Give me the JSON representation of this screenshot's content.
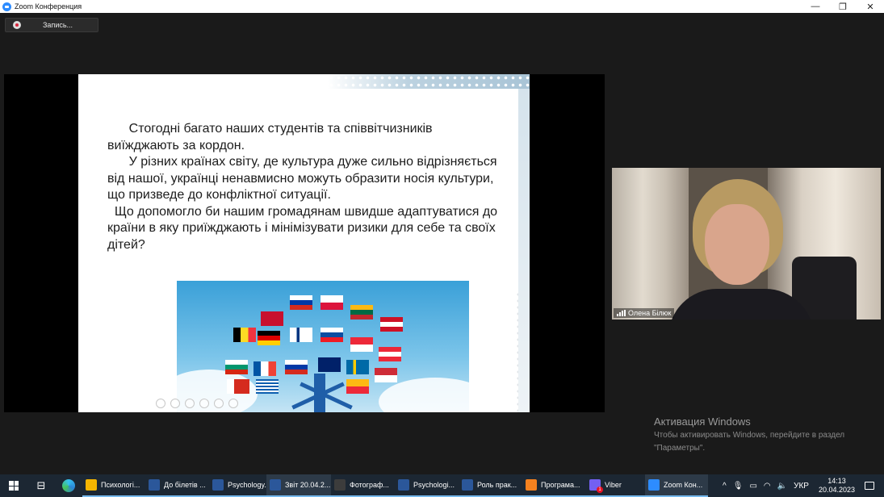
{
  "window": {
    "title": "Zoom Конференция",
    "controls": {
      "minimize": "—",
      "restore": "❐",
      "close": "✕"
    }
  },
  "recording": {
    "label": "Запись..."
  },
  "slide": {
    "paragraphs": [
      "      Стогодні багато наших студентів та співвітчизників",
      "виїжджають за кордон.",
      "      У різних країнах світу, де культура дуже сильно відрізняється",
      "від нашої, українці ненавмисно можуть образити носія культури,",
      "що призведе до конфліктної ситуації.",
      "  Що допомогло би нашим громадянам швидше адаптуватися до",
      "країни в яку приїжджають і мінімізувати ризики для себе та своїх",
      "дітей?"
    ]
  },
  "participant": {
    "name": "Олена Білюк"
  },
  "activation": {
    "title": "Активация Windows",
    "line1": "Чтобы активировать Windows, перейдите в раздел",
    "line2": "\"Параметры\"."
  },
  "taskbar": {
    "apps": [
      {
        "label": "Психологі...",
        "color": "#f4b400",
        "state": "open"
      },
      {
        "label": "До білетів ...",
        "color": "#2b579a",
        "state": "open"
      },
      {
        "label": "Psychology...",
        "color": "#2b579a",
        "state": "open"
      },
      {
        "label": "Звіт 20.04.2...",
        "color": "#2b579a",
        "state": "active"
      },
      {
        "label": "Фотограф...",
        "color": "#3c3c3c",
        "state": "open"
      },
      {
        "label": "Psychologi...",
        "color": "#2b579a",
        "state": "open"
      },
      {
        "label": "Роль прак...",
        "color": "#2b579a",
        "state": "open"
      },
      {
        "label": "Програма...",
        "color": "#f4811f",
        "state": "open"
      },
      {
        "label": "Viber",
        "color": "#7360f2",
        "state": "open",
        "badge": "1"
      },
      {
        "label": "Zoom Кон...",
        "color": "#2d8cff",
        "state": "active"
      }
    ],
    "tray": {
      "chevron": "^",
      "language": "УКР",
      "time": "14:13",
      "date": "20.04.2023"
    }
  }
}
